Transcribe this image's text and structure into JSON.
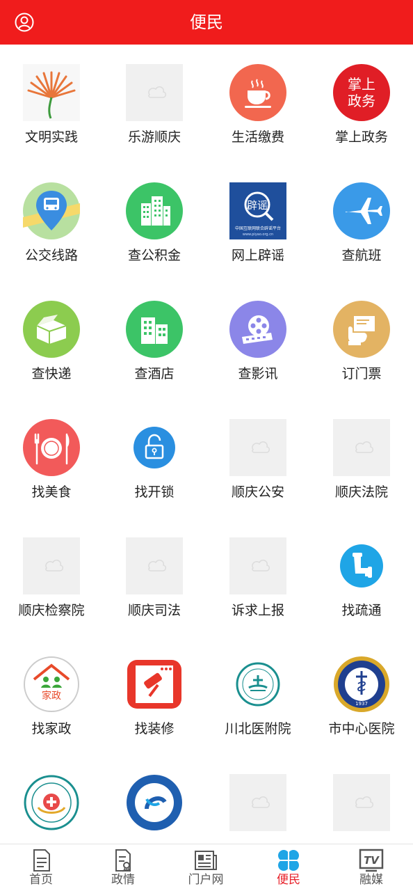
{
  "header": {
    "title": "便民",
    "profile_icon": "user-profile-icon"
  },
  "grid": [
    {
      "label": "文明实践",
      "icon": "civilization-practice-logo",
      "color": "#e8763a"
    },
    {
      "label": "乐游顺庆",
      "icon": "image-placeholder",
      "color": "#f0f0f0"
    },
    {
      "label": "生活缴费",
      "icon": "coffee-cup-icon",
      "color": "#f2674f"
    },
    {
      "label": "掌上政务",
      "icon": "mobile-government-logo",
      "color": "#e01e26",
      "logo_text": [
        "掌上",
        "政务"
      ]
    },
    {
      "label": "公交线路",
      "icon": "bus-location-icon",
      "color": "#3a8de0"
    },
    {
      "label": "查公积金",
      "icon": "buildings-icon",
      "color": "#3cc467"
    },
    {
      "label": "网上辟谣",
      "icon": "rumor-refuting-logo",
      "color": "#1f4f9c",
      "logo_text": [
        "辟谣",
        "中国互联网联合辟谣平台",
        "www.piyao.org.cn"
      ]
    },
    {
      "label": "查航班",
      "icon": "airplane-icon",
      "color": "#3a9ae8"
    },
    {
      "label": "查快递",
      "icon": "package-box-icon",
      "color": "#8ccc4f"
    },
    {
      "label": "查酒店",
      "icon": "hotel-buildings-icon",
      "color": "#3cc467"
    },
    {
      "label": "查影讯",
      "icon": "film-reel-icon",
      "color": "#8b86e8"
    },
    {
      "label": "订门票",
      "icon": "ticket-hand-icon",
      "color": "#e3b363"
    },
    {
      "label": "找美食",
      "icon": "plate-cutlery-icon",
      "color": "#f25a5a"
    },
    {
      "label": "找开锁",
      "icon": "unlock-icon",
      "color": "#2a8fe0"
    },
    {
      "label": "顺庆公安",
      "icon": "image-placeholder",
      "color": "#f0f0f0"
    },
    {
      "label": "顺庆法院",
      "icon": "image-placeholder",
      "color": "#f0f0f0"
    },
    {
      "label": "顺庆检察院",
      "icon": "image-placeholder",
      "color": "#f0f0f0"
    },
    {
      "label": "顺庆司法",
      "icon": "image-placeholder",
      "color": "#f0f0f0"
    },
    {
      "label": "诉求上报",
      "icon": "image-placeholder",
      "color": "#f0f0f0"
    },
    {
      "label": "找疏通",
      "icon": "pipe-icon",
      "color": "#1fa5e6"
    },
    {
      "label": "找家政",
      "icon": "housekeeping-logo",
      "color": "#e84a2a",
      "logo_text": [
        "家政"
      ]
    },
    {
      "label": "找装修",
      "icon": "paint-roller-icon",
      "color": "#e8362a"
    },
    {
      "label": "川北医附院",
      "icon": "hospital-emblem-logo",
      "color": "#1a8f8f"
    },
    {
      "label": "市中心医院",
      "icon": "central-hospital-emblem",
      "color": "#1f3f8f",
      "logo_text": [
        "1937"
      ]
    },
    {
      "label": "",
      "icon": "hospital-emblem-logo",
      "color": "#1a8f8f"
    },
    {
      "label": "",
      "icon": "district-hospital-emblem",
      "color": "#1f5fb0"
    },
    {
      "label": "",
      "icon": "image-placeholder",
      "color": "#f0f0f0"
    },
    {
      "label": "",
      "icon": "image-placeholder",
      "color": "#f0f0f0"
    }
  ],
  "tabs": [
    {
      "label": "首页",
      "icon": "document-icon",
      "active": false
    },
    {
      "label": "政情",
      "icon": "report-icon",
      "active": false
    },
    {
      "label": "门户网",
      "icon": "newspaper-icon",
      "active": false
    },
    {
      "label": "便民",
      "icon": "clover-icon",
      "active": true
    },
    {
      "label": "融媒",
      "icon": "tv-icon",
      "active": false,
      "icon_text": "TV"
    }
  ],
  "colors": {
    "accent": "#f01c1c",
    "active_tab": "#e8222b"
  }
}
